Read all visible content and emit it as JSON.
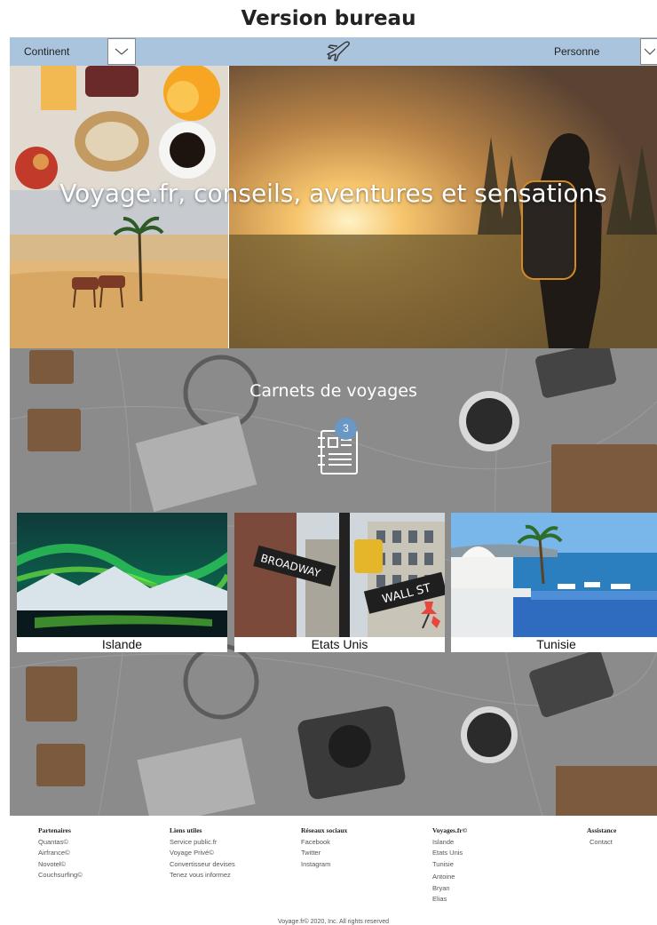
{
  "page_heading": "Version bureau",
  "nav": {
    "continent_label": "Continent",
    "personne_label": "Personne",
    "logo_icon": "airplane-icon"
  },
  "hero": {
    "title": "Voyage.fr, conseils, aventures et sensations"
  },
  "carnets": {
    "title": "Carnets de voyages",
    "badge_count": "3",
    "icon": "notebook-icon"
  },
  "destinations": [
    {
      "label": "Islande"
    },
    {
      "label": "Etats Unis"
    },
    {
      "label": "Tunisie"
    }
  ],
  "footer": {
    "columns": [
      {
        "heading": "Partenaires",
        "items": [
          "Quantas©",
          "Airfrance©",
          "Novotel©",
          "Couchsurfing©"
        ]
      },
      {
        "heading": "Liens utiles",
        "items": [
          "Service public.fr",
          "Voyage Privé©",
          "Convertisseur devises",
          "Tenez vous informez"
        ]
      },
      {
        "heading": "Réseaux sociaux",
        "items": [
          "Facebook",
          "Twitter",
          "Instagram"
        ]
      },
      {
        "heading": "Voyages.fr©",
        "items": [
          "Islande",
          "Etats Unis",
          "Tunisie",
          "Antoine",
          "Bryan",
          "Elias"
        ]
      },
      {
        "heading": "Assistance",
        "items": [
          "Contact"
        ]
      }
    ],
    "copyright": "Voyage.fr© 2020, Inc. All rights reserved"
  }
}
